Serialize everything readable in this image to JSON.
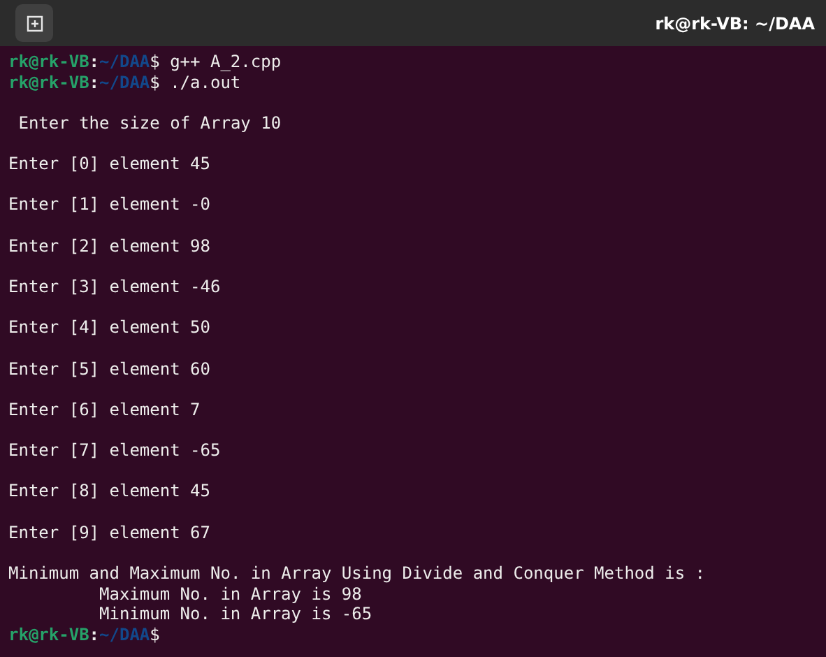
{
  "window": {
    "title": "rk@rk-VB: ~/DAA"
  },
  "terminal": {
    "lines": [
      {
        "kind": "prompt",
        "user": "rk@rk-VB",
        "separator": ":",
        "path": "~/DAA",
        "symbol": "$",
        "command": "g++ A_2.cpp"
      },
      {
        "kind": "prompt",
        "user": "rk@rk-VB",
        "separator": ":",
        "path": "~/DAA",
        "symbol": "$",
        "command": "./a.out"
      },
      {
        "kind": "blank"
      },
      {
        "kind": "output",
        "text": " Enter the size of Array 10"
      },
      {
        "kind": "blank"
      },
      {
        "kind": "output",
        "text": "Enter [0] element 45"
      },
      {
        "kind": "blank"
      },
      {
        "kind": "output",
        "text": "Enter [1] element -0"
      },
      {
        "kind": "blank"
      },
      {
        "kind": "output",
        "text": "Enter [2] element 98"
      },
      {
        "kind": "blank"
      },
      {
        "kind": "output",
        "text": "Enter [3] element -46"
      },
      {
        "kind": "blank"
      },
      {
        "kind": "output",
        "text": "Enter [4] element 50"
      },
      {
        "kind": "blank"
      },
      {
        "kind": "output",
        "text": "Enter [5] element 60"
      },
      {
        "kind": "blank"
      },
      {
        "kind": "output",
        "text": "Enter [6] element 7"
      },
      {
        "kind": "blank"
      },
      {
        "kind": "output",
        "text": "Enter [7] element -65"
      },
      {
        "kind": "blank"
      },
      {
        "kind": "output",
        "text": "Enter [8] element 45"
      },
      {
        "kind": "blank"
      },
      {
        "kind": "output",
        "text": "Enter [9] element 67"
      },
      {
        "kind": "blank"
      },
      {
        "kind": "output",
        "text": "Minimum and Maximum No. in Array Using Divide and Conquer Method is :"
      },
      {
        "kind": "indented",
        "text": "Maximum No. in Array is 98"
      },
      {
        "kind": "indented",
        "text": "Minimum No. in Array is -65"
      },
      {
        "kind": "prompt",
        "user": "rk@rk-VB",
        "separator": ":",
        "path": "~/DAA",
        "symbol": "$"
      }
    ]
  }
}
